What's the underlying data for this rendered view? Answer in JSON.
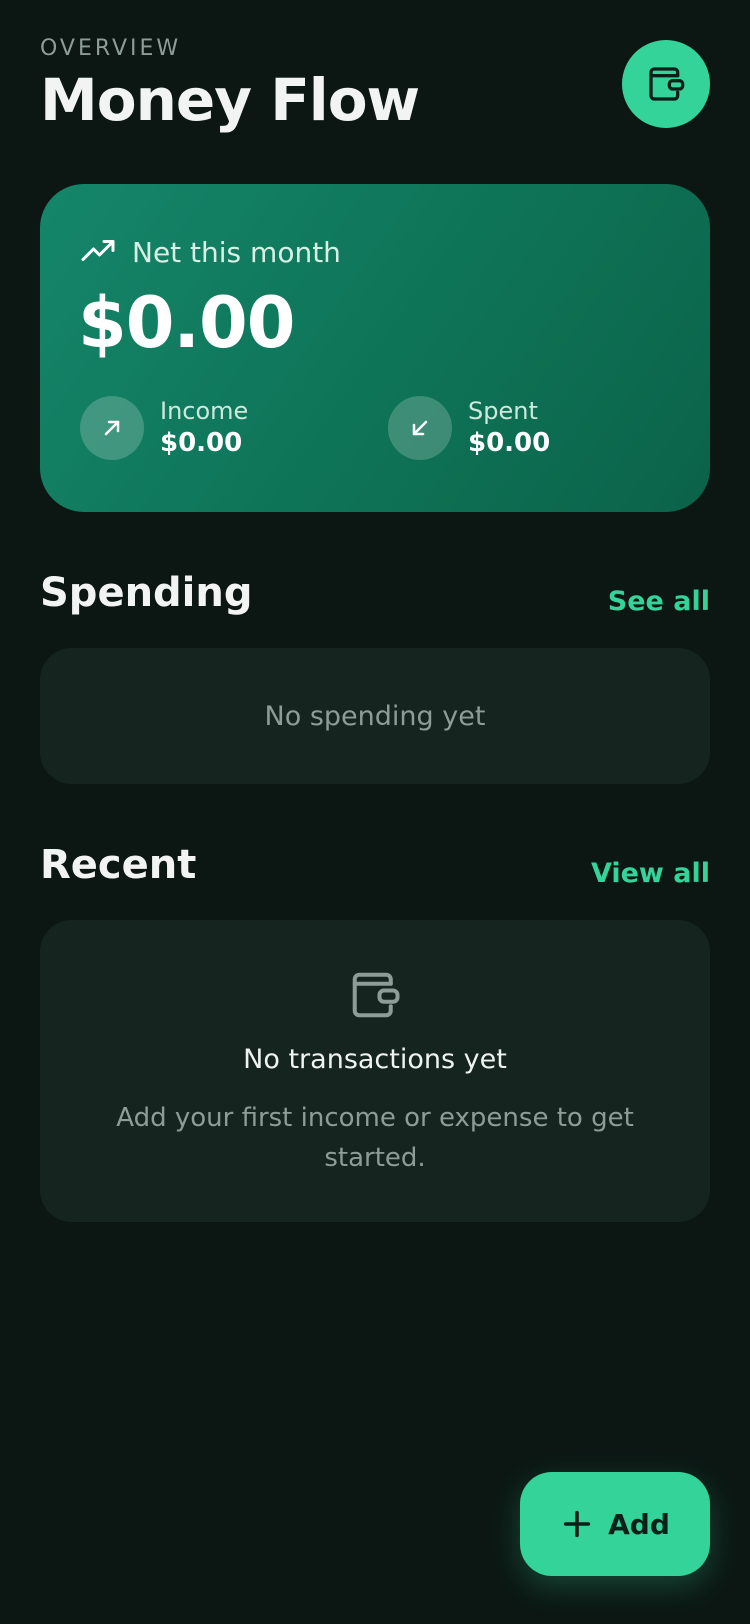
{
  "header": {
    "eyebrow": "OVERVIEW",
    "title": "Money Flow",
    "wallet_icon": "wallet-icon"
  },
  "hero": {
    "label": "Net this month",
    "label_icon": "trending-up-icon",
    "amount": "$0.00",
    "income": {
      "label": "Income",
      "value": "$0.00",
      "icon": "arrow-up-right-icon"
    },
    "spent": {
      "label": "Spent",
      "value": "$0.00",
      "icon": "arrow-down-left-icon"
    }
  },
  "spending": {
    "title": "Spending",
    "link": "See all",
    "empty": "No spending yet"
  },
  "recent": {
    "title": "Recent",
    "link": "View all",
    "empty_icon": "wallet-icon",
    "empty_title": "No transactions yet",
    "empty_desc": "Add your first income or expense to get started."
  },
  "fab": {
    "label": "Add",
    "icon": "plus-icon"
  },
  "colors": {
    "background": "#0c1714",
    "accent": "#34d399",
    "card": "#16241f",
    "hero_start": "#15866a",
    "hero_end": "#0b6349",
    "muted_text": "#8e9c97"
  }
}
